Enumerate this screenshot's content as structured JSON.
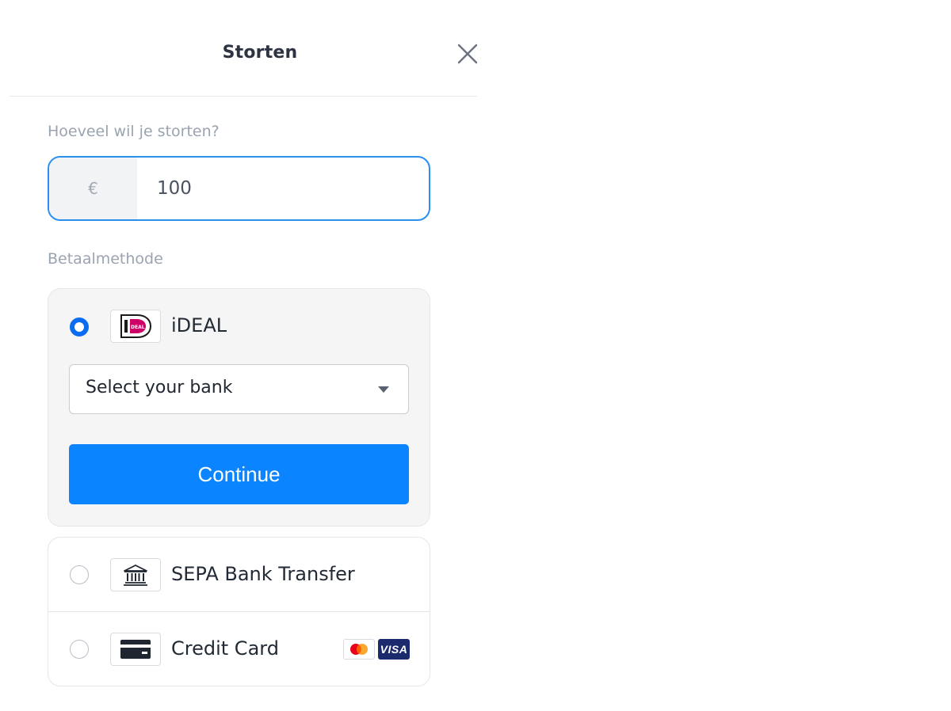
{
  "header": {
    "title": "Storten"
  },
  "amount": {
    "label": "Hoeveel wil je storten?",
    "currency_symbol": "€",
    "value": "100"
  },
  "payment": {
    "label": "Betaalmethode",
    "methods": [
      {
        "id": "ideal",
        "label": "iDEAL",
        "selected": true,
        "icon": "ideal-logo-icon"
      },
      {
        "id": "sepa",
        "label": "SEPA Bank Transfer",
        "selected": false,
        "icon": "bank-icon"
      },
      {
        "id": "card",
        "label": "Credit Card",
        "selected": false,
        "icon": "credit-card-icon"
      }
    ],
    "bank_select": {
      "placeholder": "Select your bank"
    },
    "continue_label": "Continue",
    "card_brands": {
      "mastercard_icon": "mastercard-icon",
      "visa_text": "VISA"
    }
  },
  "colors": {
    "accent": "#0a84ff",
    "input_border": "#2a8ef0",
    "radio_selected": "#0a6cf0",
    "ideal_pink": "#cc0066"
  }
}
